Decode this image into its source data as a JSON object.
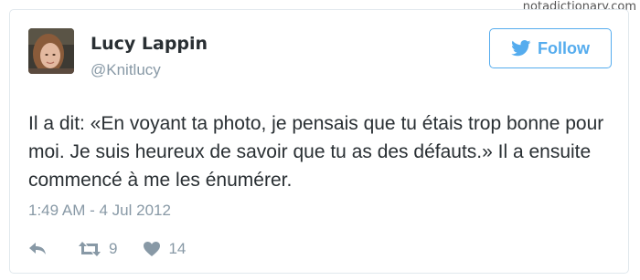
{
  "watermark": "notadictionary.com",
  "tweet": {
    "author_name": "Lucy Lappin",
    "author_handle": "@Knitlucy",
    "follow_label": "Follow",
    "text": "Il a dit: «En voyant ta photo, je pensais que tu étais trop bonne pour moi. Je suis heureux de savoir que tu as des défauts.» Il a ensuite commencé à me les énumérer.",
    "timestamp": "1:49 AM - 4 Jul 2012",
    "retweet_count": "9",
    "like_count": "14"
  },
  "icons": {
    "follow": "twitter-bird-icon",
    "reply": "reply-icon",
    "retweet": "retweet-icon",
    "like": "heart-icon"
  },
  "colors": {
    "accent": "#55acee",
    "text": "#292f33",
    "muted": "#8899a6",
    "border": "#e1e8ed"
  }
}
